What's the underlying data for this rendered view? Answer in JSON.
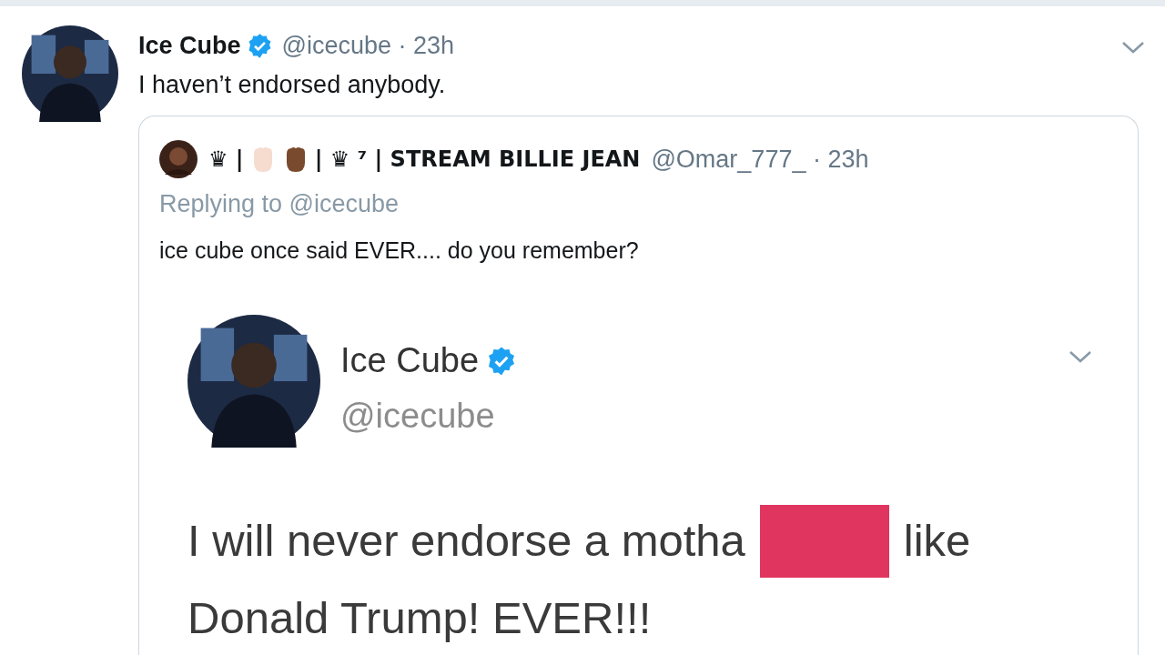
{
  "tweet": {
    "name": "Ice Cube",
    "verified": true,
    "handle": "@icecube · 23h",
    "text": "I haven’t endorsed anybody.",
    "quoted_tweet": {
      "name_start": "♛ |",
      "name_end": "| ♛ ⁷ | STREAM BILLIE JEAN",
      "handle": "@Omar_777_ · 23h",
      "replying_to": "Replying to @icecube",
      "text": "ice cube once said EVER.... do you remember?",
      "embedded_screenshot": {
        "name": "Ice Cube",
        "verified": true,
        "handle": "@icecube",
        "text_before_redaction": "I will never endorse a motha",
        "redacted": true,
        "text_after_redaction": "like",
        "second_line": "Donald Trump! EVER!!!"
      }
    }
  }
}
